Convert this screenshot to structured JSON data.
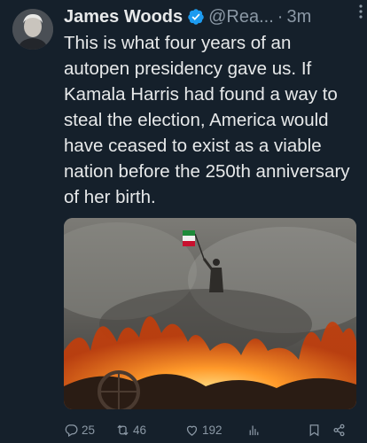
{
  "tweet": {
    "author_name": "James Woods",
    "handle": "@Rea...",
    "separator": "·",
    "time": "3m",
    "text": "This is what four years of an autopen presidency gave us. If Kamala Harris had found a way to steal the election, America would have ceased to exist as a viable nation before the 250th anniversary of her birth."
  },
  "actions": {
    "reply_count": "25",
    "retweet_count": "46",
    "like_count": "192"
  },
  "colors": {
    "background": "#15202b",
    "verified_badge": "#1d9bf0",
    "muted_text": "#8b98a5"
  },
  "icons": [
    "more-icon",
    "verified-badge-icon",
    "reply-icon",
    "retweet-icon",
    "like-icon",
    "views-icon",
    "bookmark-icon",
    "share-icon"
  ]
}
